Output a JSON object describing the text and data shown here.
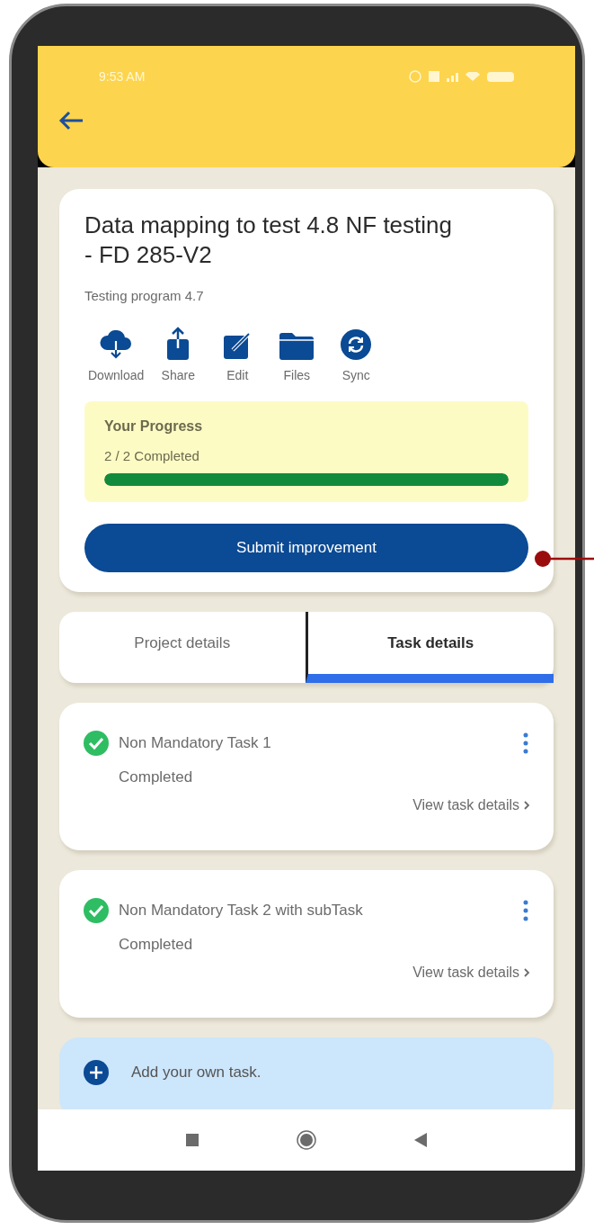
{
  "status_bar": {
    "time": "9:53 AM"
  },
  "project": {
    "title": "Data mapping to test 4.8 NF testing - FD 285-V2",
    "subtitle": "Testing program 4.7",
    "actions": [
      {
        "kind": "download",
        "label": "Download"
      },
      {
        "kind": "share",
        "label": "Share"
      },
      {
        "kind": "edit",
        "label": "Edit"
      },
      {
        "kind": "files",
        "label": "Files"
      },
      {
        "kind": "sync",
        "label": "Sync"
      }
    ],
    "progress": {
      "title": "Your Progress",
      "reading": "2 / 2 Completed",
      "level": 1
    },
    "submit_button": "Submit improvement"
  },
  "tabs": [
    {
      "label": "Project details",
      "selected": false
    },
    {
      "label": "Task details",
      "selected": true
    }
  ],
  "tasks": [
    {
      "name": "Non Mandatory Task 1",
      "status": "Completed",
      "done": true,
      "link": "View task details"
    },
    {
      "name": "Non Mandatory Task 2 with subTask",
      "status": "Completed",
      "done": true,
      "link": "View task details"
    }
  ],
  "add_task": {
    "label": "Add your own task."
  }
}
